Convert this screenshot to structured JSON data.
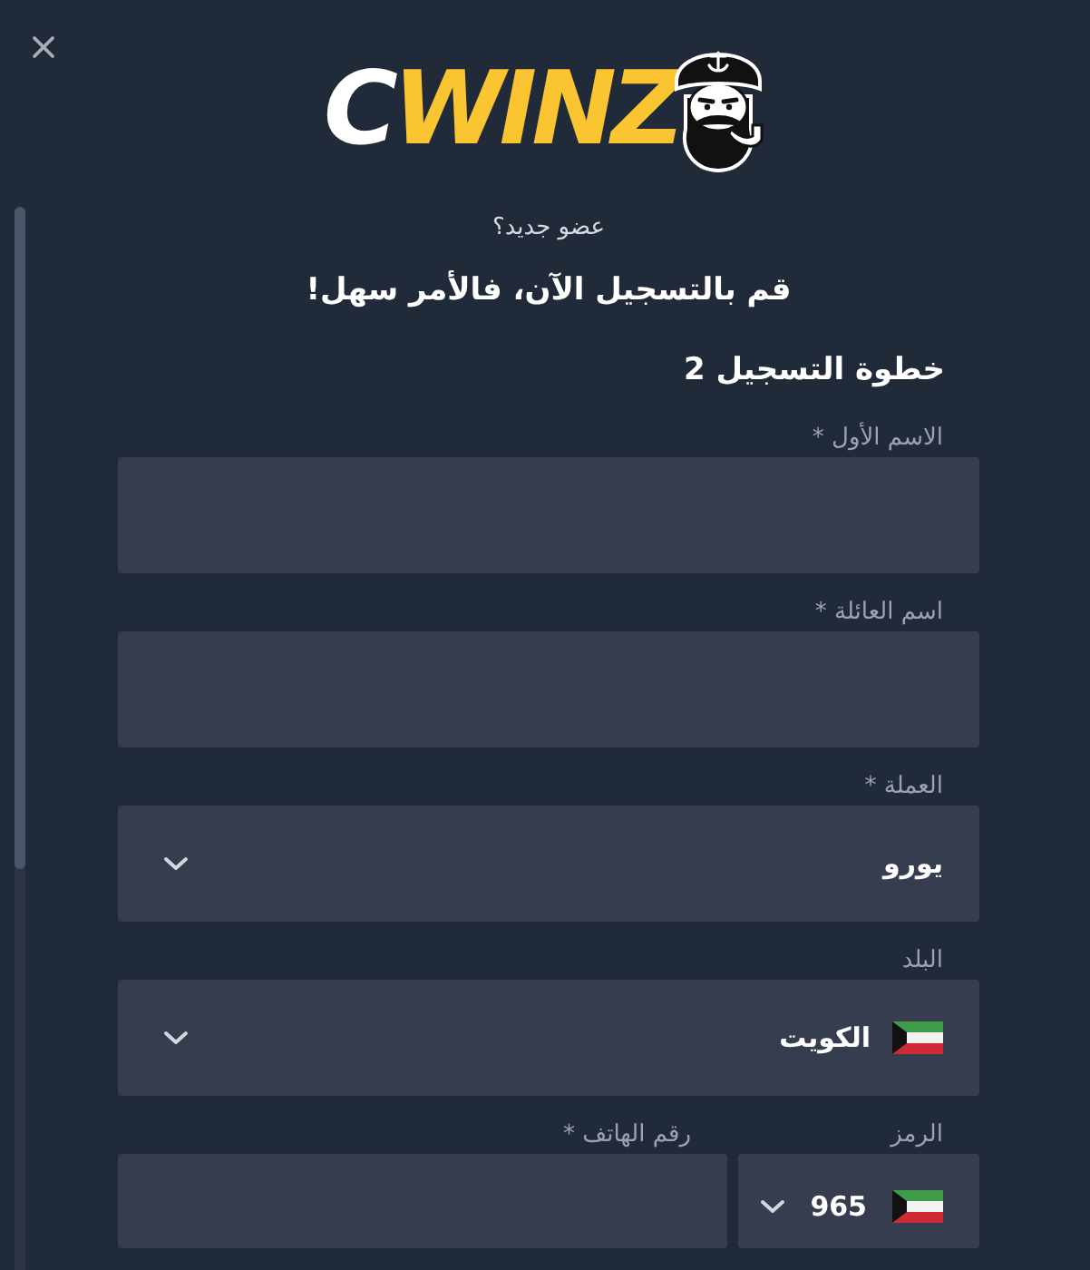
{
  "logo": {
    "lead": "C",
    "rest": "WINZ"
  },
  "intro": {
    "question": "عضو جديد؟",
    "headline": "قم بالتسجيل الآن، فالأمر سهل!"
  },
  "step_title": "خطوة التسجيل 2",
  "fields": [
    {
      "kind": "text",
      "label": "الاسم الأول *"
    },
    {
      "kind": "text",
      "label": "اسم العائلة *"
    },
    {
      "kind": "select",
      "label": "العملة *",
      "value": "يورو"
    },
    {
      "kind": "country",
      "label": "البلد",
      "value": "الكويت"
    }
  ],
  "phone": {
    "code": {
      "label": "الرمز",
      "value": "965"
    },
    "number": {
      "label": "رقم الهاتف *"
    }
  }
}
